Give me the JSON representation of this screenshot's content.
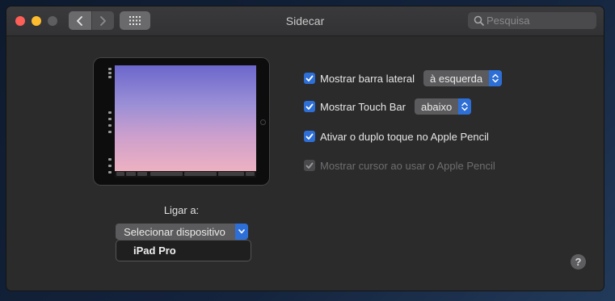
{
  "window": {
    "title": "Sidecar"
  },
  "search": {
    "placeholder": "Pesquisa",
    "value": ""
  },
  "connect": {
    "label": "Ligar a:",
    "selected": "Selecionar dispositivo",
    "menu_items": [
      "iPad Pro"
    ]
  },
  "options": [
    {
      "label": "Mostrar barra lateral",
      "checked": true,
      "enabled": true,
      "select_value": "à esquerda"
    },
    {
      "label": "Mostrar Touch Bar",
      "checked": true,
      "enabled": true,
      "select_value": "abaixo"
    },
    {
      "label": "Ativar o duplo toque no Apple Pencil",
      "checked": true,
      "enabled": true
    },
    {
      "label": "Mostrar cursor ao usar o Apple Pencil",
      "checked": true,
      "enabled": false
    }
  ],
  "help": {
    "label": "?"
  },
  "colors": {
    "accent": "#2d6fd6",
    "window_bg": "#2b2b2c"
  },
  "icons": [
    "close-icon",
    "minimize-icon",
    "maximize-icon",
    "chevron-left-icon",
    "chevron-right-icon",
    "grid-icon",
    "search-icon",
    "checkmark-icon",
    "popup-arrows-icon",
    "help-icon"
  ]
}
